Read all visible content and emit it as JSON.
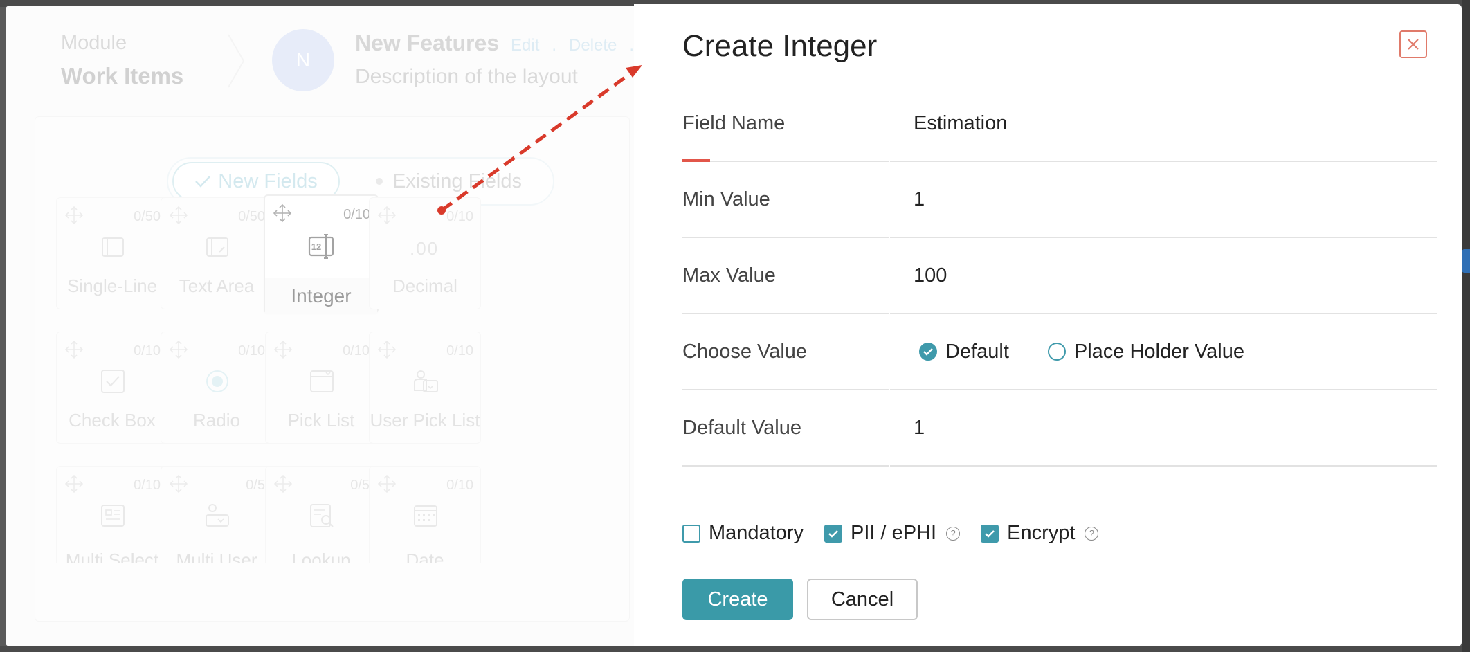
{
  "background": {
    "module_label": "Module",
    "module_name": "Work Items",
    "avatar_initial": "N",
    "layout_title": "New Features",
    "layout_actions": [
      "Edit",
      ".",
      "Delete",
      "."
    ],
    "layout_description": "Description of the layout",
    "toggle": {
      "new_fields": "New Fields",
      "existing_fields": "Existing Fields"
    },
    "tiles": [
      {
        "label": "Single-Line",
        "count": "0/50",
        "icon": "single-line-icon"
      },
      {
        "label": "Text Area",
        "count": "0/50",
        "icon": "text-area-icon"
      },
      {
        "label": "Integer",
        "count": "0/10",
        "icon": "integer-icon"
      },
      {
        "label": "Decimal",
        "count": "0/10",
        "icon": "decimal-icon",
        "glyph": ".00"
      },
      {
        "label": "Check Box",
        "count": "0/10",
        "icon": "check-box-icon"
      },
      {
        "label": "Radio",
        "count": "0/10",
        "icon": "radio-icon"
      },
      {
        "label": "Pick List",
        "count": "0/10",
        "icon": "pick-list-icon"
      },
      {
        "label": "User Pick List",
        "count": "0/10",
        "icon": "user-pick-list-icon"
      },
      {
        "label": "Multi Select",
        "count": "0/10",
        "icon": "multi-select-icon"
      },
      {
        "label": "Multi User",
        "count": "0/5",
        "icon": "multi-user-icon"
      },
      {
        "label": "Lookup",
        "count": "0/5",
        "icon": "lookup-icon"
      },
      {
        "label": "Date",
        "count": "0/10",
        "icon": "date-icon"
      }
    ]
  },
  "dialog": {
    "title": "Create Integer",
    "fields": {
      "field_name": {
        "label": "Field Name",
        "value": "Estimation"
      },
      "min_value": {
        "label": "Min Value",
        "value": "1"
      },
      "max_value": {
        "label": "Max Value",
        "value": "100"
      },
      "choose_value": {
        "label": "Choose Value",
        "options": [
          "Default",
          "Place Holder Value"
        ],
        "selected": "Default"
      },
      "default_value": {
        "label": "Default Value",
        "value": "1"
      }
    },
    "checkboxes": {
      "mandatory": {
        "label": "Mandatory",
        "checked": false
      },
      "pii": {
        "label": "PII / ePHI",
        "checked": true
      },
      "encrypt": {
        "label": "Encrypt",
        "checked": true
      }
    },
    "help_glyph": "?",
    "buttons": {
      "create": "Create",
      "cancel": "Cancel"
    }
  },
  "colors": {
    "accent": "#3a9aa8",
    "close_red": "#e07a6a",
    "focus_red": "#e2564a",
    "arrow_red": "#d93a2b"
  }
}
